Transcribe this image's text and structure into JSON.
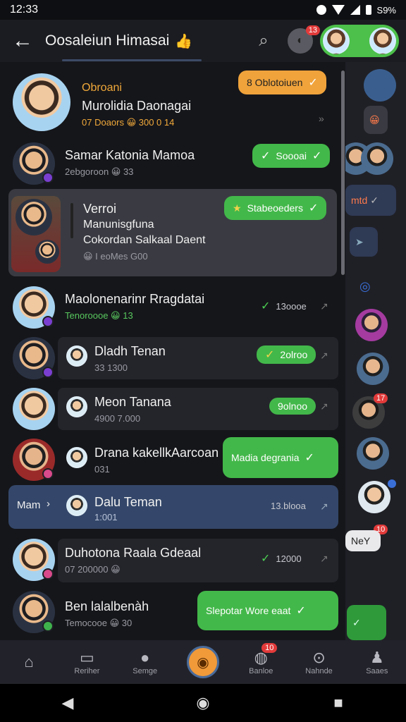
{
  "status": {
    "time": "12:33",
    "battery": "S9%"
  },
  "appbar": {
    "title": "Oosaleiun Himasai",
    "title_emoji": "👍",
    "chat_badge": "13"
  },
  "list": [
    {
      "pre": "Obroani",
      "name": "Murolidia Daonagai",
      "sub": "07 Doaors 😀 300 0 14",
      "pill": "8 Oblotoiuen",
      "pill_color": "orange"
    },
    {
      "name": "Samar Katonia Mamoa",
      "sub": "2ebgoroon 😀 33",
      "pill": "Soooai",
      "pill_color": "green"
    },
    {
      "pre": "Verroi",
      "name": "Manunisgfuna",
      "sub2": "Cokordan Salkaal Daent",
      "sub": "😀 I eoMes G00",
      "pill": "Stabeoeders",
      "pill_color": "green"
    },
    {
      "name": "Maolonenarinr Rragdatai",
      "sub": "Tenoroooe 😀 13",
      "time": "13oooe"
    },
    {
      "name": "Dladh Tenan",
      "sub": "33 1300",
      "pill": "2olroo",
      "pill_color": "green"
    },
    {
      "name": "Meon Tanana",
      "sub": "4900 7.000",
      "pill": "9olnoo",
      "pill_color": "green"
    },
    {
      "name": "Drana kakellkAarcoan",
      "sub": "031",
      "pill": "Madia degrania",
      "pill_color": "green"
    },
    {
      "pre": "Mam",
      "name": "Dalu Teman",
      "sub": "1:001",
      "time": "13.blooa"
    },
    {
      "name": "Duhotona Raala Gdeaal",
      "sub": "07 200000 😀",
      "time": "12000"
    },
    {
      "name": "Ben lalalbenàh",
      "sub": "Temocooe 😀 30",
      "pill": "Slepotar Wore eaat",
      "pill_color": "green"
    }
  ],
  "right_column": {
    "bubble1": "mtd",
    "badge1": "17",
    "badge2": "10",
    "bubble2": "NeY"
  },
  "bottomnav": [
    {
      "label": "",
      "icon": "home-icon"
    },
    {
      "label": "Reriher",
      "icon": "reriher-icon"
    },
    {
      "label": "Semge",
      "icon": "chat-bubble-icon"
    },
    {
      "label": "",
      "icon": "center-action-icon"
    },
    {
      "label": "Banloe",
      "icon": "banloe-icon",
      "badge": "10"
    },
    {
      "label": "Nahnde",
      "icon": "nahnde-icon"
    },
    {
      "label": "Saaes",
      "icon": "profile-icon"
    }
  ]
}
